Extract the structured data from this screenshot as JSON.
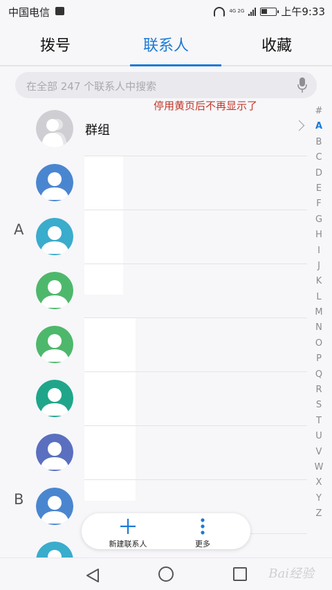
{
  "status_bar": {
    "carrier": "中国电信",
    "network": "4G 2G",
    "time": "上午9:33"
  },
  "tabs": [
    {
      "label": "拨号"
    },
    {
      "label": "联系人"
    },
    {
      "label": "收藏"
    }
  ],
  "search": {
    "placeholder": "在全部 247 个联系人中搜索"
  },
  "watermark_note": "停用黄页后不再显示了",
  "group_row": {
    "name": "群组"
  },
  "sections": {
    "a": "A",
    "b": "B"
  },
  "avatar_colors": [
    "#4a86d0",
    "#3aaccc",
    "#4db86b",
    "#4db86b",
    "#1fa68a",
    "#5a6fbf",
    "#4a86d0",
    "#3aaccc"
  ],
  "index_letters": [
    "#",
    "A",
    "B",
    "C",
    "D",
    "E",
    "F",
    "G",
    "H",
    "I",
    "J",
    "K",
    "L",
    "M",
    "N",
    "O",
    "P",
    "Q",
    "R",
    "S",
    "T",
    "U",
    "V",
    "W",
    "X",
    "Y",
    "Z"
  ],
  "active_index": "A",
  "fab": {
    "add_label": "新建联系人",
    "more_label": "更多"
  },
  "brand_watermark": "Bai经验",
  "accent_color": "#1a7ad6"
}
